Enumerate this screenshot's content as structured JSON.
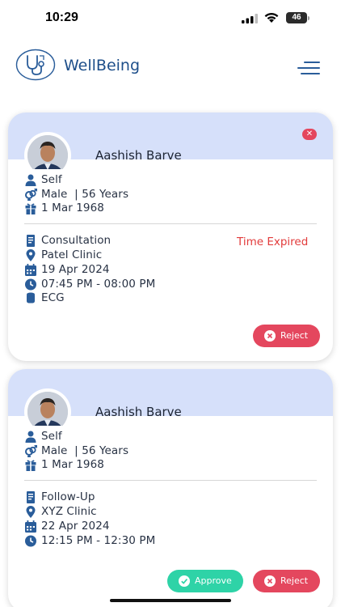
{
  "status_bar": {
    "time": "10:29",
    "battery": "46"
  },
  "header": {
    "brand": "WellBeing",
    "logo_icon": "stethoscope-icon",
    "menu_icon": "hamburger-menu-icon",
    "brand_color": "#1e4f8a"
  },
  "appointments": [
    {
      "patient_name": "Aashish Barve",
      "relation": "Self",
      "gender_age": "Male  | 56 Years",
      "dob": "1 Mar 1968",
      "type": "Consultation",
      "clinic": "Patel Clinic",
      "date": "19 Apr 2024",
      "time": "07:45 PM - 08:00 PM",
      "service": "ECG",
      "status": "Time Expired",
      "reject_label": "Reject"
    },
    {
      "patient_name": "Aashish Barve",
      "relation": "Self",
      "gender_age": "Male  | 56 Years",
      "dob": "1 Mar 1968",
      "type": "Follow-Up",
      "clinic": "XYZ Clinic",
      "date": "22 Apr 2024",
      "time": "12:15 PM - 12:30 PM",
      "approve_label": "Approve",
      "reject_label": "Reject"
    }
  ],
  "colors": {
    "accent": "#2a5d9a",
    "card_header": "#d6e0fa",
    "reject": "#e4475e",
    "approve": "#2ed3a7",
    "expired": "#e23b3b"
  }
}
